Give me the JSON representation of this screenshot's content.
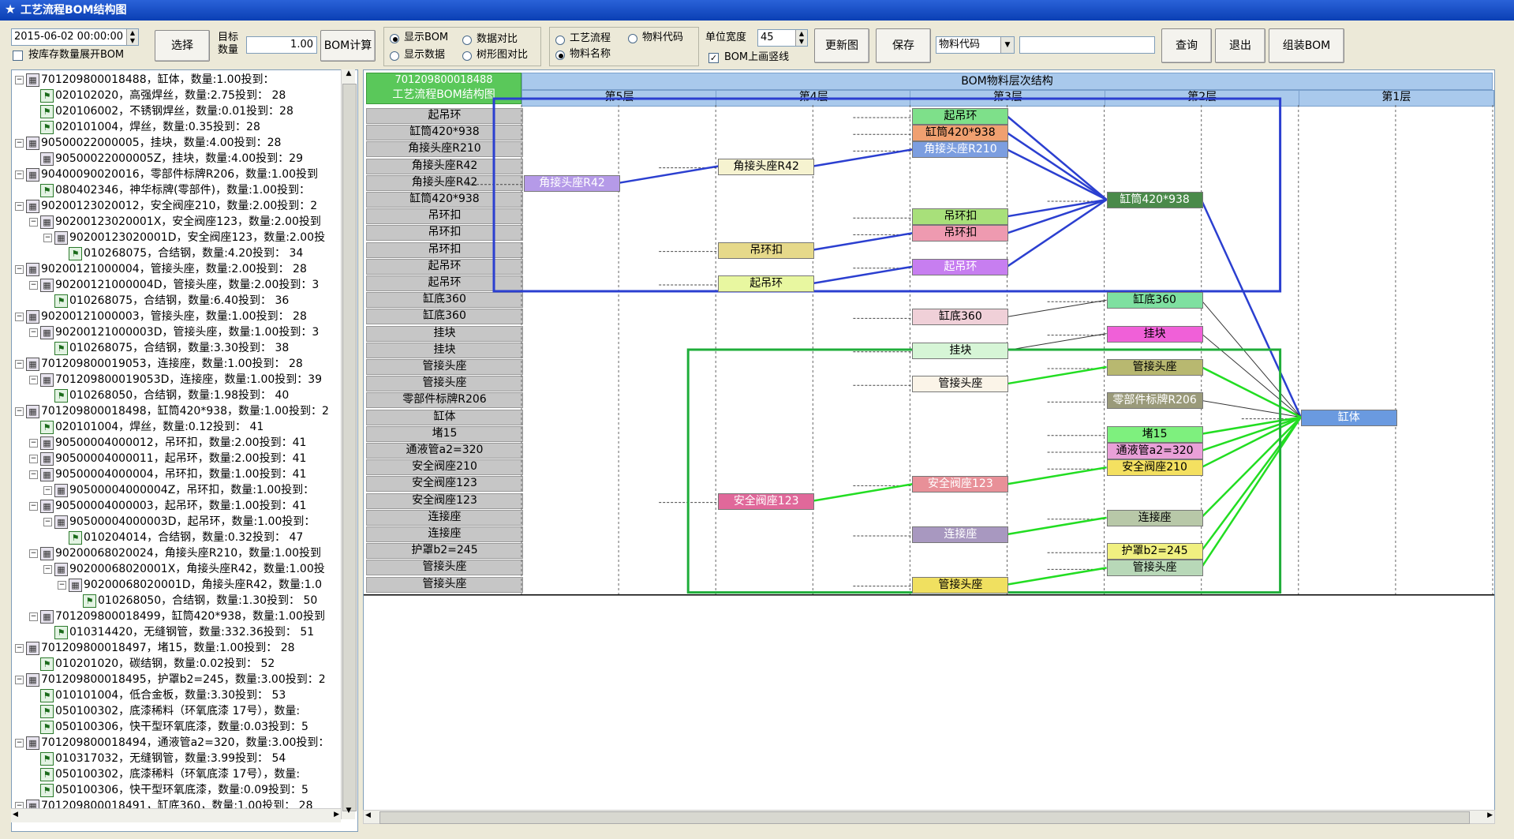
{
  "window": {
    "title": "工艺流程BOM结构图",
    "icon": "star-app-icon"
  },
  "toolbar": {
    "datetime": "2015-06-02 00:00:00",
    "checkbox_expand_label": "按库存数量展开BOM",
    "select_label": "选择",
    "target_qty_label": "目标\n数量",
    "target_qty_value": "1.00",
    "bom_calc_label": "BOM计算",
    "radio_show_bom": "显示BOM",
    "radio_data_compare": "数据对比",
    "radio_show_data": "显示数据",
    "radio_tree_compare": "树形图对比",
    "radio_process": "工艺流程",
    "radio_material_code": "物料代码",
    "radio_material_name": "物料名称",
    "unit_width_label": "单位宽度",
    "unit_width_value": "45",
    "bom_vline_label": "BOM上画竖线",
    "update_graph_label": "更新图",
    "save_label": "保存",
    "filter_select_value": "物料代码",
    "filter_input_value": "",
    "query_label": "查询",
    "exit_label": "退出",
    "assemble_label": "组装BOM"
  },
  "tree": {
    "items": [
      {
        "level": 0,
        "expander": "−",
        "icon": "assembly",
        "text": "701209800018488，缸体，数量:1.00投到："
      },
      {
        "level": 1,
        "expander": "",
        "icon": "leaf",
        "text": "020102020，高强焊丝，数量:2.75投到： 28"
      },
      {
        "level": 1,
        "expander": "",
        "icon": "leaf",
        "text": "020106002，不锈钢焊丝，数量:0.01投到：28"
      },
      {
        "level": 1,
        "expander": "",
        "icon": "leaf",
        "text": "020101004，焊丝，数量:0.35投到：28"
      },
      {
        "level": 0,
        "expander": "−",
        "icon": "assembly",
        "text": "90500022000005，挂块，数量:4.00投到：28"
      },
      {
        "level": 1,
        "expander": "",
        "icon": "assembly",
        "text": "90500022000005Z，挂块，数量:4.00投到：29"
      },
      {
        "level": 0,
        "expander": "−",
        "icon": "assembly",
        "text": "90400090020016，零部件标牌R206，数量:1.00投到"
      },
      {
        "level": 1,
        "expander": "",
        "icon": "leaf",
        "text": "080402346，神华标牌(零部件)，数量:1.00投到："
      },
      {
        "level": 0,
        "expander": "−",
        "icon": "assembly",
        "text": "90200123020012，安全阀座210，数量:2.00投到：2"
      },
      {
        "level": 1,
        "expander": "−",
        "icon": "assembly",
        "text": "90200123020001X，安全阀座123，数量:2.00投到"
      },
      {
        "level": 2,
        "expander": "−",
        "icon": "assembly",
        "text": "90200123020001D，安全阀座123，数量:2.00投"
      },
      {
        "level": 3,
        "expander": "",
        "icon": "leaf",
        "text": "010268075，合结钢，数量:4.20投到： 34"
      },
      {
        "level": 0,
        "expander": "−",
        "icon": "assembly",
        "text": "90200121000004，管接头座，数量:2.00投到： 28"
      },
      {
        "level": 1,
        "expander": "−",
        "icon": "assembly",
        "text": "90200121000004D，管接头座，数量:2.00投到：3"
      },
      {
        "level": 2,
        "expander": "",
        "icon": "leaf",
        "text": "010268075，合结钢，数量:6.40投到： 36"
      },
      {
        "level": 0,
        "expander": "−",
        "icon": "assembly",
        "text": "90200121000003，管接头座，数量:1.00投到： 28"
      },
      {
        "level": 1,
        "expander": "−",
        "icon": "assembly",
        "text": "90200121000003D，管接头座，数量:1.00投到：3"
      },
      {
        "level": 2,
        "expander": "",
        "icon": "leaf",
        "text": "010268075，合结钢，数量:3.30投到： 38"
      },
      {
        "level": 0,
        "expander": "−",
        "icon": "assembly",
        "text": "701209800019053，连接座，数量:1.00投到： 28"
      },
      {
        "level": 1,
        "expander": "−",
        "icon": "assembly",
        "text": "701209800019053D，连接座，数量:1.00投到：39"
      },
      {
        "level": 2,
        "expander": "",
        "icon": "leaf",
        "text": "010268050，合结钢，数量:1.98投到： 40"
      },
      {
        "level": 0,
        "expander": "−",
        "icon": "assembly",
        "text": "701209800018498，缸筒420*938，数量:1.00投到：2"
      },
      {
        "level": 1,
        "expander": "",
        "icon": "leaf",
        "text": "020101004，焊丝，数量:0.12投到： 41"
      },
      {
        "level": 1,
        "expander": "−",
        "icon": "assembly",
        "text": "90500004000012，吊环扣，数量:2.00投到：41"
      },
      {
        "level": 1,
        "expander": "−",
        "icon": "assembly",
        "text": "90500004000011，起吊环，数量:2.00投到：41"
      },
      {
        "level": 1,
        "expander": "−",
        "icon": "assembly",
        "text": "90500004000004，吊环扣，数量:1.00投到：41"
      },
      {
        "level": 2,
        "expander": "−",
        "icon": "assembly",
        "text": "90500004000004Z，吊环扣，数量:1.00投到："
      },
      {
        "level": 1,
        "expander": "−",
        "icon": "assembly",
        "text": "90500004000003，起吊环，数量:1.00投到：41"
      },
      {
        "level": 2,
        "expander": "−",
        "icon": "assembly",
        "text": "90500004000003D，起吊环，数量:1.00投到："
      },
      {
        "level": 3,
        "expander": "",
        "icon": "leaf",
        "text": "010204014，合结钢，数量:0.32投到： 47"
      },
      {
        "level": 1,
        "expander": "−",
        "icon": "assembly",
        "text": "90200068020024，角接头座R210，数量:1.00投到"
      },
      {
        "level": 2,
        "expander": "−",
        "icon": "assembly",
        "text": "90200068020001X，角接头座R42，数量:1.00投"
      },
      {
        "level": 3,
        "expander": "−",
        "icon": "assembly",
        "text": "90200068020001D，角接头座R42，数量:1.0"
      },
      {
        "level": 4,
        "expander": "",
        "icon": "leaf",
        "text": "010268050，合结钢，数量:1.30投到： 50"
      },
      {
        "level": 1,
        "expander": "−",
        "icon": "assembly",
        "text": "701209800018499，缸筒420*938，数量:1.00投到"
      },
      {
        "level": 2,
        "expander": "",
        "icon": "leaf",
        "text": "010314420，无缝钢管，数量:332.36投到： 51"
      },
      {
        "level": 0,
        "expander": "−",
        "icon": "assembly",
        "text": "701209800018497，堵15，数量:1.00投到： 28"
      },
      {
        "level": 1,
        "expander": "",
        "icon": "leaf",
        "text": "010201020，碳结钢，数量:0.02投到： 52"
      },
      {
        "level": 0,
        "expander": "−",
        "icon": "assembly",
        "text": "701209800018495，护罩b2=245，数量:3.00投到：2"
      },
      {
        "level": 1,
        "expander": "",
        "icon": "leaf",
        "text": "010101004，低合金板，数量:3.30投到： 53"
      },
      {
        "level": 1,
        "expander": "",
        "icon": "leaf",
        "text": "050100302，底漆稀料（环氧底漆 17号），数量:"
      },
      {
        "level": 1,
        "expander": "",
        "icon": "leaf",
        "text": "050100306，快干型环氧底漆，数量:0.03投到：5"
      },
      {
        "level": 0,
        "expander": "−",
        "icon": "assembly",
        "text": "701209800018494，通液管a2=320，数量:3.00投到："
      },
      {
        "level": 1,
        "expander": "",
        "icon": "leaf",
        "text": "010317032，无缝钢管，数量:3.99投到： 54"
      },
      {
        "level": 1,
        "expander": "",
        "icon": "leaf",
        "text": "050100302，底漆稀料（环氧底漆 17号），数量:"
      },
      {
        "level": 1,
        "expander": "",
        "icon": "leaf",
        "text": "050100306，快干型环氧底漆，数量:0.09投到：5"
      },
      {
        "level": 0,
        "expander": "−",
        "icon": "assembly",
        "text": "701209800018491，缸底360，数量:1.00投到： 28"
      }
    ]
  },
  "diagram": {
    "root_code": "701209800018488",
    "root_title": "工艺流程BOM结构图",
    "header": "BOM物料层次结构",
    "layers": [
      "第5层",
      "第4层",
      "第3层",
      "第2层",
      "第1层"
    ],
    "row_labels": [
      "起吊环",
      "缸筒420*938",
      "角接头座R210",
      "角接头座R42",
      "角接头座R42",
      "缸筒420*938",
      "吊环扣",
      "吊环扣",
      "吊环扣",
      "起吊环",
      "起吊环",
      "缸底360",
      "缸底360",
      "挂块",
      "挂块",
      "管接头座",
      "管接头座",
      "零部件标牌R206",
      "缸体",
      "堵15",
      "通液管a2=320",
      "安全阀座210",
      "安全阀座123",
      "安全阀座123",
      "连接座",
      "连接座",
      "护罩b2=245",
      "管接头座",
      "管接头座"
    ],
    "nodes": [
      {
        "id": "n3a",
        "text": "起吊环",
        "row": 0,
        "col": 2,
        "color": "#7ee08a"
      },
      {
        "id": "n3b",
        "text": "缸筒420*938",
        "row": 1,
        "col": 2,
        "color": "#f0a070"
      },
      {
        "id": "n3c",
        "text": "角接头座R210",
        "row": 2,
        "col": 2,
        "color": "#7c9ee0"
      },
      {
        "id": "n4a",
        "text": "角接头座R42",
        "row": 3,
        "col": 1,
        "color": "#f6f3d0"
      },
      {
        "id": "n5a",
        "text": "角接头座R42",
        "row": 4,
        "col": 0,
        "color": "#b59ae8"
      },
      {
        "id": "n2a",
        "text": "缸筒420*938",
        "row": 5,
        "col": 3,
        "color": "#4a8a4a"
      },
      {
        "id": "n3d",
        "text": "吊环扣",
        "row": 6,
        "col": 2,
        "color": "#a8e07a"
      },
      {
        "id": "n3e",
        "text": "吊环扣",
        "row": 7,
        "col": 2,
        "color": "#ee9ab0"
      },
      {
        "id": "n4b",
        "text": "吊环扣",
        "row": 8,
        "col": 1,
        "color": "#e6d98a"
      },
      {
        "id": "n3f",
        "text": "起吊环",
        "row": 9,
        "col": 2,
        "color": "#c77ef0"
      },
      {
        "id": "n4c",
        "text": "起吊环",
        "row": 10,
        "col": 1,
        "color": "#e8f7a0"
      },
      {
        "id": "n2b",
        "text": "缸底360",
        "row": 11,
        "col": 3,
        "color": "#7ee0a0"
      },
      {
        "id": "n3g",
        "text": "缸底360",
        "row": 12,
        "col": 2,
        "color": "#f0d0d8"
      },
      {
        "id": "n2c",
        "text": "挂块",
        "row": 13,
        "col": 3,
        "color": "#f060d8"
      },
      {
        "id": "n3h",
        "text": "挂块",
        "row": 14,
        "col": 2,
        "color": "#d6f5d6"
      },
      {
        "id": "n2d",
        "text": "管接头座",
        "row": 15,
        "col": 3,
        "color": "#b8b870"
      },
      {
        "id": "n3i",
        "text": "管接头座",
        "row": 16,
        "col": 2,
        "color": "#fbf4e8"
      },
      {
        "id": "n2e",
        "text": "零部件标牌R206",
        "row": 17,
        "col": 3,
        "color": "#9a9a7a"
      },
      {
        "id": "n1a",
        "text": "缸体",
        "row": 18,
        "col": 4,
        "color": "#6a9ae0"
      },
      {
        "id": "n2f",
        "text": "堵15",
        "row": 19,
        "col": 3,
        "color": "#7ef07e"
      },
      {
        "id": "n2g",
        "text": "通液管a2=320",
        "row": 20,
        "col": 3,
        "color": "#e9a0d8"
      },
      {
        "id": "n2h",
        "text": "安全阀座210",
        "row": 21,
        "col": 3,
        "color": "#f4e060"
      },
      {
        "id": "n3j",
        "text": "安全阀座123",
        "row": 22,
        "col": 2,
        "color": "#e89098"
      },
      {
        "id": "n4d",
        "text": "安全阀座123",
        "row": 23,
        "col": 1,
        "color": "#e0689a"
      },
      {
        "id": "n2i",
        "text": "连接座",
        "row": 24,
        "col": 3,
        "color": "#b8c8a8"
      },
      {
        "id": "n3k",
        "text": "连接座",
        "row": 25,
        "col": 2,
        "color": "#a898c0"
      },
      {
        "id": "n2j",
        "text": "护罩b2=245",
        "row": 26,
        "col": 3,
        "color": "#f0f080"
      },
      {
        "id": "n2k",
        "text": "管接头座",
        "row": 27,
        "col": 3,
        "color": "#b8d8b8"
      },
      {
        "id": "n3l",
        "text": "管接头座",
        "row": 28,
        "col": 2,
        "color": "#f0e060"
      }
    ],
    "edges": [
      {
        "from": "n5a",
        "to": "n4a",
        "color": "#2b3fd0"
      },
      {
        "from": "n4a",
        "to": "n3c",
        "color": "#2b3fd0"
      },
      {
        "from": "n4b",
        "to": "n3e",
        "color": "#2b3fd0"
      },
      {
        "from": "n4c",
        "to": "n3f",
        "color": "#2b3fd0"
      },
      {
        "from": "n3a",
        "to": "n2a",
        "color": "#2b3fd0"
      },
      {
        "from": "n3b",
        "to": "n2a",
        "color": "#2b3fd0"
      },
      {
        "from": "n3c",
        "to": "n2a",
        "color": "#2b3fd0"
      },
      {
        "from": "n3d",
        "to": "n2a",
        "color": "#2b3fd0"
      },
      {
        "from": "n3e",
        "to": "n2a",
        "color": "#2b3fd0"
      },
      {
        "from": "n3f",
        "to": "n2a",
        "color": "#2b3fd0"
      },
      {
        "from": "n2a",
        "to": "n1a",
        "color": "#2b3fd0"
      },
      {
        "from": "n3g",
        "to": "n2b",
        "color": "#333333"
      },
      {
        "from": "n3h",
        "to": "n2c",
        "color": "#333333"
      },
      {
        "from": "n2b",
        "to": "n1a",
        "color": "#333333"
      },
      {
        "from": "n2c",
        "to": "n1a",
        "color": "#333333"
      },
      {
        "from": "n2e",
        "to": "n1a",
        "color": "#333333"
      },
      {
        "from": "n3i",
        "to": "n2d",
        "color": "#22dd22"
      },
      {
        "from": "n4d",
        "to": "n3j",
        "color": "#22dd22"
      },
      {
        "from": "n3j",
        "to": "n2h",
        "color": "#22dd22"
      },
      {
        "from": "n3k",
        "to": "n2i",
        "color": "#22dd22"
      },
      {
        "from": "n3l",
        "to": "n2k",
        "color": "#22dd22"
      },
      {
        "from": "n2d",
        "to": "n1a",
        "color": "#22dd22"
      },
      {
        "from": "n2f",
        "to": "n1a",
        "color": "#22dd22"
      },
      {
        "from": "n2g",
        "to": "n1a",
        "color": "#22dd22"
      },
      {
        "from": "n2h",
        "to": "n1a",
        "color": "#22dd22"
      },
      {
        "from": "n2i",
        "to": "n1a",
        "color": "#22dd22"
      },
      {
        "from": "n2j",
        "to": "n1a",
        "color": "#22dd22"
      },
      {
        "from": "n2k",
        "to": "n1a",
        "color": "#22dd22"
      }
    ]
  },
  "colors": {
    "blue_box": "#2b3fd0",
    "green_box": "#1fae3a",
    "root_header": "#5ac85a",
    "layer_header": "#a9c9ec"
  }
}
